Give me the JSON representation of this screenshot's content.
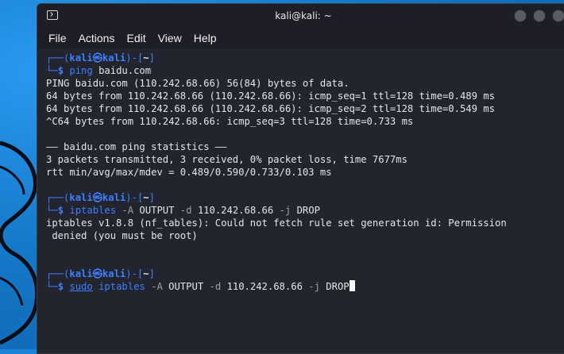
{
  "window": {
    "title": "kali@kali: ~"
  },
  "menu": [
    "File",
    "Actions",
    "Edit",
    "View",
    "Help"
  ],
  "prompt": {
    "top_open": "┌──(",
    "user": "kali",
    "at": "㉿",
    "host": "kali",
    "close_open": ")-[",
    "dir": "~",
    "close": "]",
    "bottom": "└─",
    "dollar": "$"
  },
  "blocks": [
    {
      "command_parts": [
        {
          "text": "ping",
          "cls": "cmd"
        },
        {
          "text": " baidu.com",
          "cls": "arg"
        }
      ],
      "output": [
        "PING baidu.com (110.242.68.66) 56(84) bytes of data.",
        "64 bytes from 110.242.68.66 (110.242.68.66): icmp_seq=1 ttl=128 time=0.489 ms",
        "64 bytes from 110.242.68.66 (110.242.68.66): icmp_seq=2 ttl=128 time=0.549 ms",
        "^C64 bytes from 110.242.68.66: icmp_seq=3 ttl=128 time=0.733 ms",
        "",
        "—— baidu.com ping statistics ——",
        "3 packets transmitted, 3 received, 0% packet loss, time 7677ms",
        "rtt min/avg/max/mdev = 0.489/0.590/0.733/0.103 ms",
        ""
      ]
    },
    {
      "command_parts": [
        {
          "text": "iptables",
          "cls": "cmd"
        },
        {
          "text": " -A",
          "cls": "flag"
        },
        {
          "text": " OUTPUT",
          "cls": "arg"
        },
        {
          "text": " -d",
          "cls": "flag"
        },
        {
          "text": " 110.242.68.66",
          "cls": "arg"
        },
        {
          "text": " -j",
          "cls": "flag"
        },
        {
          "text": " DROP",
          "cls": "arg"
        }
      ],
      "output": [
        "iptables v1.8.8 (nf_tables): Could not fetch rule set generation id: Permission",
        " denied (you must be root)",
        "",
        ""
      ]
    },
    {
      "command_parts": [
        {
          "text": "sudo",
          "cls": "cmd underline"
        },
        {
          "text": " iptables",
          "cls": "cmd"
        },
        {
          "text": " -A",
          "cls": "flag"
        },
        {
          "text": " OUTPUT",
          "cls": "arg"
        },
        {
          "text": " -d",
          "cls": "flag"
        },
        {
          "text": " 110.242.68.66",
          "cls": "arg"
        },
        {
          "text": " -j",
          "cls": "flag"
        },
        {
          "text": " DROP",
          "cls": "arg"
        }
      ],
      "output": [],
      "cursor": true
    }
  ]
}
